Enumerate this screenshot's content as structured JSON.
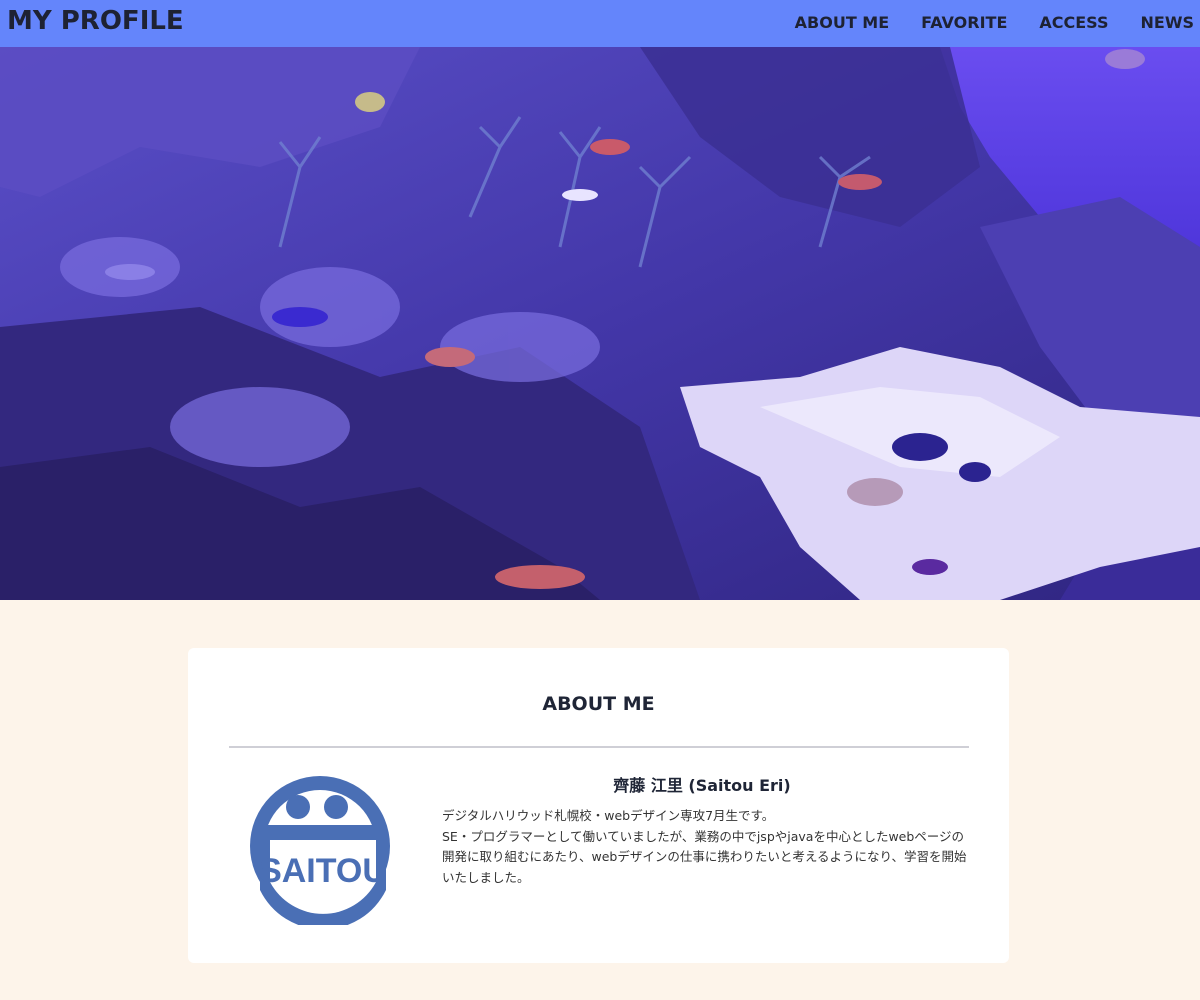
{
  "header": {
    "title": "MY PROFILE",
    "nav": [
      {
        "label": "ABOUT ME"
      },
      {
        "label": "FAVORITE"
      },
      {
        "label": "ACCESS"
      },
      {
        "label": "NEWS"
      }
    ]
  },
  "hero": {
    "icon": "aquarium-coral-reef-photo"
  },
  "about": {
    "title": "ABOUT ME",
    "name": "齊藤 江里 (Saitou Eri)",
    "logo_text": "SAITOU",
    "bio": [
      "デジタルハリウッド札幌校・webデザイン専攻7月生です。",
      "SE・プログラマーとして働いていましたが、業務の中でjspやjavaを中心としたwebページの開発に取り組むにあたり、webデザインの仕事に携わりたいと考えるようになり、学習を開始いたしました。"
    ]
  },
  "colors": {
    "header_bg": "#6485fb",
    "page_bg": "#fdf4ea",
    "logo_blue": "#4a6fb5"
  }
}
